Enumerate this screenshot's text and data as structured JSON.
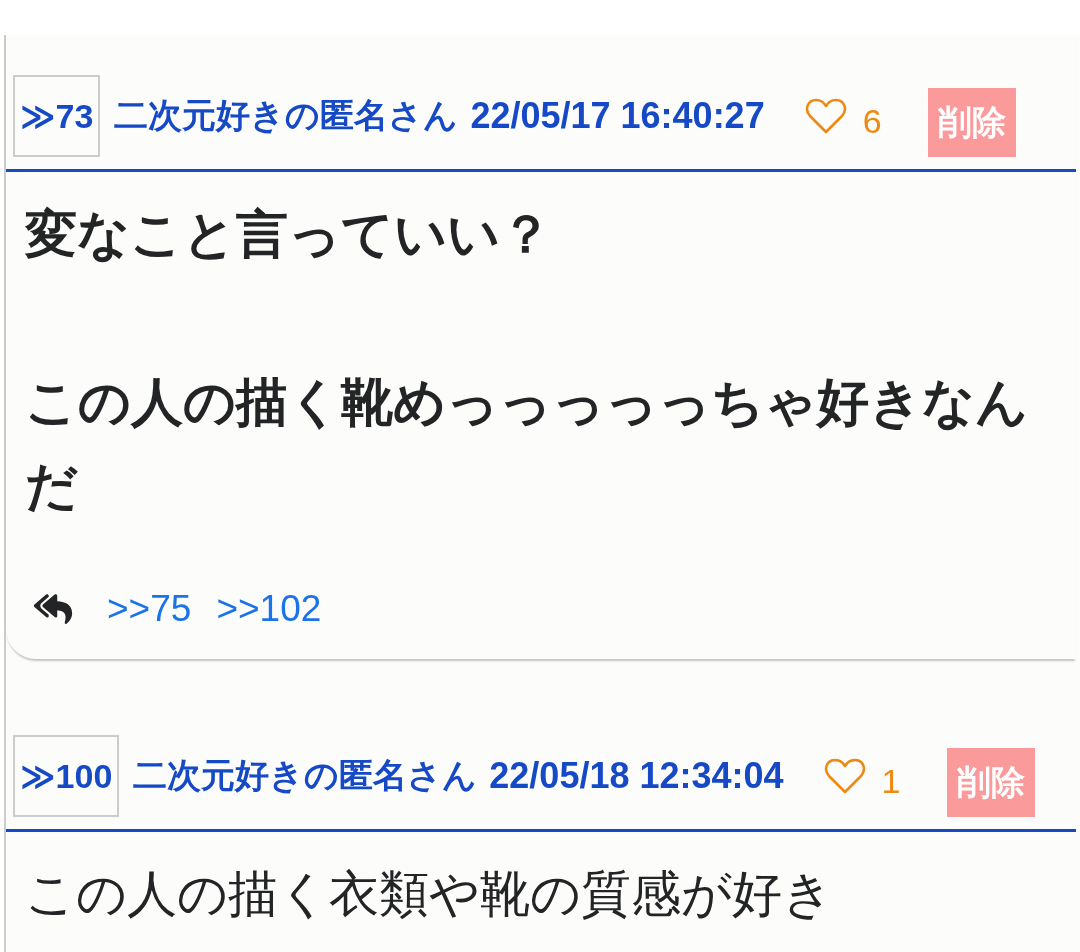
{
  "posts": [
    {
      "number": "≫73",
      "name": "二次元好きの匿名さん",
      "date": "22/05/17 16:40:27",
      "likes": "6",
      "delete_label": "削除",
      "bold": true,
      "paragraphs": [
        "変なこと言っていい？",
        "この人の描く靴めっっっっっちゃ好きなんだ"
      ],
      "replies": [
        ">>75",
        ">>102"
      ]
    },
    {
      "number": "≫100",
      "name": "二次元好きの匿名さん",
      "date": "22/05/18 12:34:04",
      "likes": "1",
      "delete_label": "削除",
      "bold": false,
      "paragraphs": [
        "この人の描く衣類や靴の質感が好き"
      ]
    }
  ]
}
